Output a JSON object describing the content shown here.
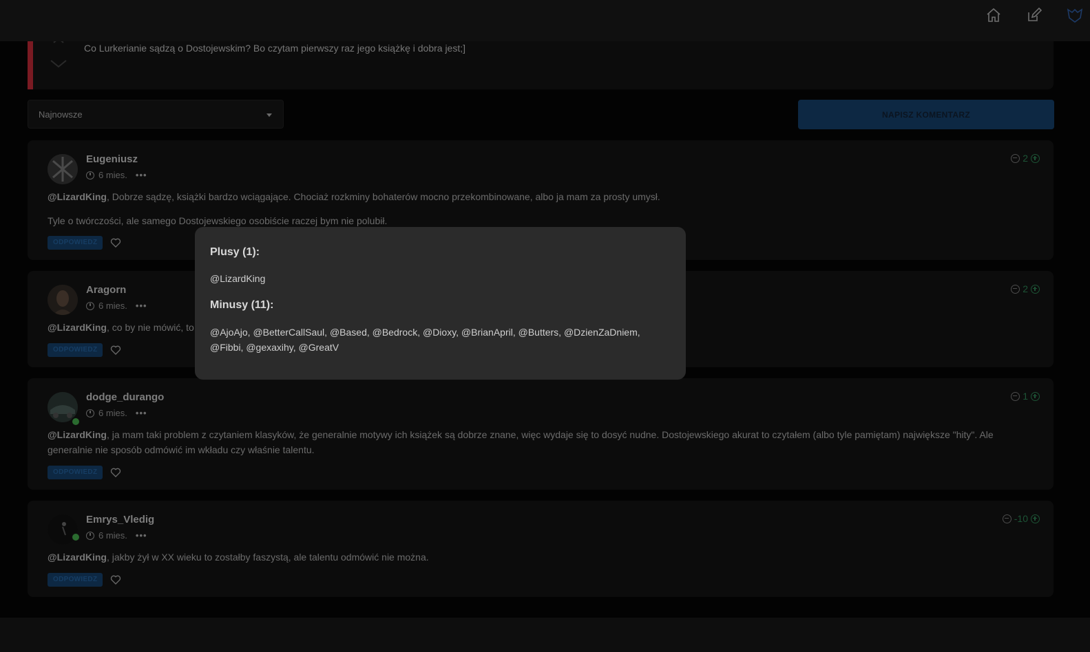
{
  "post": {
    "text": "Co Lurkerianie sądzą o Dostojewskim? Bo czytam pierwszy raz jego książkę i dobra jest;]"
  },
  "controls": {
    "sort_selected": "Najnowsze",
    "write_comment_label": "NAPISZ KOMENTARZ"
  },
  "comments": [
    {
      "author": "Eugeniusz",
      "time": "6 mies.",
      "score": "2",
      "mention": "@LizardKing",
      "paragraphs": [
        ", Dobrze sądzę, książki bardzo wciągające. Chociaż rozkminy bohaterów mocno przekombinowane, albo ja mam za prosty umysł.",
        "Tyle o twórczości, ale samego Dostojewskiego osobiście raczej bym nie polubił."
      ],
      "reply_label": "ODPOWIEDZ"
    },
    {
      "author": "Aragorn",
      "time": "6 mies.",
      "score": "2",
      "mention": "@LizardKing",
      "paragraphs": [
        ", co by nie mówić, to"
      ],
      "reply_label": "ODPOWIEDZ"
    },
    {
      "author": "dodge_durango",
      "time": "6 mies.",
      "score": "1",
      "mention": "@LizardKing",
      "paragraphs": [
        ", ja mam taki problem z czytaniem klasyków, że generalnie motywy ich książek są dobrze znane, więc wydaje się to dosyć nudne. Dostojewskiego akurat to czytałem (albo tyle pamiętam) największe \"hity\". Ale generalnie nie sposób odmówić im wkładu czy właśnie talentu."
      ],
      "reply_label": "ODPOWIEDZ"
    },
    {
      "author": "Emrys_Vledig",
      "time": "6 mies.",
      "score": "-10",
      "mention": "@LizardKing",
      "paragraphs": [
        ", jakby żył w XX wieku to zostałby faszystą, ale talentu odmówić nie można."
      ],
      "reply_label": "ODPOWIEDZ"
    }
  ],
  "popup": {
    "plus_title": "Plusy (1):",
    "plus_list": "@LizardKing",
    "minus_title": "Minusy (11):",
    "minus_list_line1": "@AjoAjo, @BetterCallSaul, @Based, @Bedrock, @Dioxy, @BrianApril, @Butters, @DzienZaDniem,",
    "minus_list_line2": "@Fibbi, @gexaxihy, @GreatV"
  },
  "icons": {
    "home": "home-icon",
    "edit": "edit-icon",
    "logo": "wolf-logo-icon"
  },
  "colors": {
    "reply_button_bg": "#0d2843",
    "score_green": "#1d5436",
    "popup_bg": "#2b2b2b",
    "accent_red": "#7a1a22"
  }
}
